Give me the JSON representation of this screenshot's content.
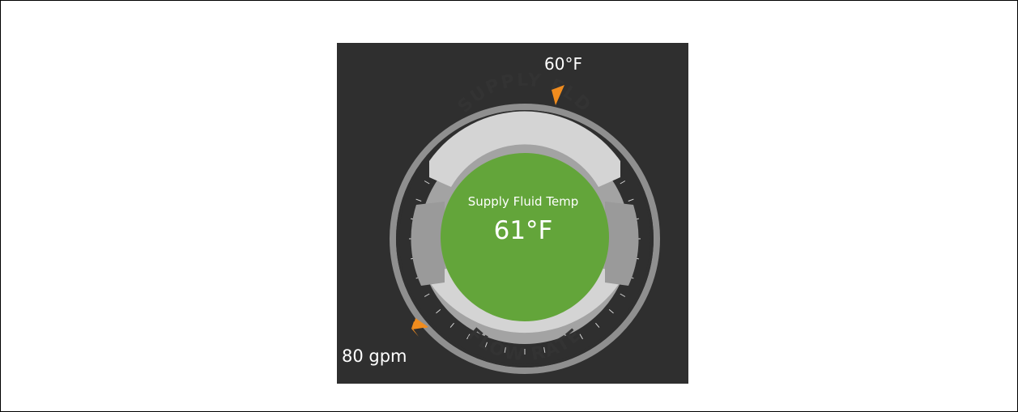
{
  "gauge": {
    "top_label": "SUPPLY FLD",
    "bottom_label": "FLOW RATE",
    "center_title": "Supply Fluid Temp",
    "center_value": "61°F",
    "top_setpoint_label": "60°F",
    "bottom_setpoint_label": "80 gpm"
  },
  "colors": {
    "panel_background": "#2f2f2f",
    "outer_ring": "#8f8f8f",
    "inner_disc": "#a3a3a3",
    "label_band": "#d4d4d4",
    "center_disc": "#63a53a",
    "marker": "#f08c1e",
    "tick": "#d8d8d8",
    "text_light": "#ffffff",
    "text_dark": "#333333"
  },
  "icons": {
    "top_marker": "triangle-marker-icon",
    "bottom_marker": "triangle-marker-icon"
  }
}
